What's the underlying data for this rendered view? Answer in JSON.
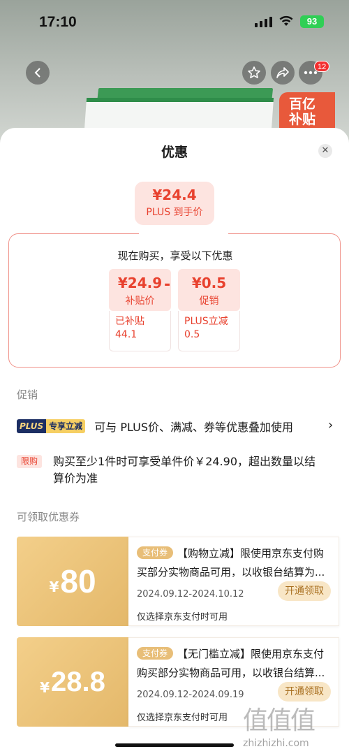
{
  "status_bar": {
    "time": "17:10",
    "battery": "93"
  },
  "header": {
    "cart_badge": "12",
    "sticker": "百亿补贴"
  },
  "sheet": {
    "title": "优惠",
    "final_price": {
      "amount": "¥24.4",
      "label": "PLUS 到手价"
    },
    "summary": {
      "title": "现在购买，享受以下优惠",
      "minus": "-",
      "items": [
        {
          "amount": "¥24.9",
          "label": "补贴价",
          "sub": "已补贴\n44.1"
        },
        {
          "amount": "¥0.5",
          "label": "促销",
          "sub": "PLUS立减\n0.5"
        }
      ]
    },
    "promo_section": {
      "label": "促销",
      "plus_tag": [
        "PLUS",
        "专享立减"
      ],
      "plus_text": "可与 PLUS价、满减、券等优惠叠加使用",
      "limit_tag": "限购",
      "limit_text": "购买至少1件时可享受单件价￥24.90，超出数量以结算价为准"
    },
    "coupon_section": {
      "label": "可领取优惠券",
      "coupons": [
        {
          "currency": "¥",
          "value": "80",
          "tag": "支付券",
          "title": "【购物立减】限使用京东支付购买部分实物商品可用，以收银台结算为...",
          "date": "2024.09.12-2024.10.12",
          "note": "仅选择京东支付时可用",
          "button": "开通领取"
        },
        {
          "currency": "¥",
          "value": "28.8",
          "tag": "支付券",
          "title": "【无门槛立减】限使用京东支付购买部分实物商品可用，以收银台结算...",
          "date": "2024.09.12-2024.09.19",
          "note": "仅选择京东支付时可用",
          "button": "开通领取"
        }
      ]
    }
  },
  "watermark": {
    "glyphs": "值值值",
    "site": "zhizhizhi.com"
  },
  "colors": {
    "accent": "#e8412e",
    "gold": "#e4b86a"
  }
}
